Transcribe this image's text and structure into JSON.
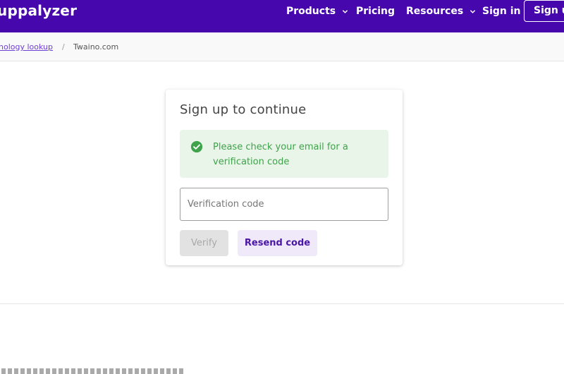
{
  "header": {
    "logo": "uppalyzer",
    "nav": {
      "products": "Products",
      "pricing": "Pricing",
      "resources": "Resources",
      "sign_in": "Sign in",
      "sign_up": "Sign up"
    },
    "bg_color": "#4608ad"
  },
  "breadcrumb": {
    "parent": "nology lookup",
    "separator": "/",
    "current": "Twaino.com"
  },
  "card": {
    "title": "Sign up to continue",
    "alert": {
      "text": "Please check your email for a verification code",
      "icon": "check-circle-icon",
      "color": "#3ea34a"
    },
    "input": {
      "placeholder": "Verification code",
      "value": ""
    },
    "buttons": {
      "verify": "Verify",
      "resend": "Resend code"
    }
  }
}
